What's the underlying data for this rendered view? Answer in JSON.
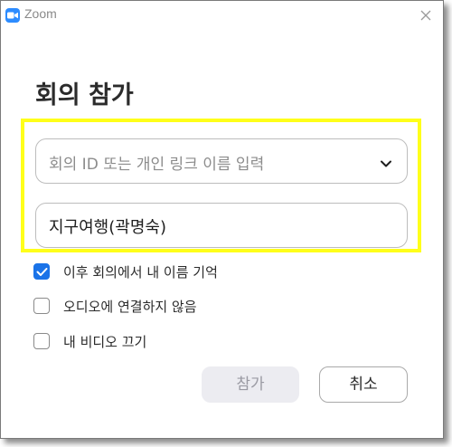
{
  "window": {
    "app_title": "Zoom",
    "logo_icon": "zoom-camera-icon",
    "close_icon": "close-icon"
  },
  "dialog": {
    "heading": "회의 참가",
    "meeting_id": {
      "value": "",
      "placeholder": "회의 ID 또는 개인 링크 이름 입력",
      "dropdown_icon": "chevron-down-icon"
    },
    "name": {
      "value": "지구여행(곽명숙)"
    },
    "highlight_color": "#ffff1a",
    "options": [
      {
        "label": "이후 회의에서 내 이름 기억",
        "checked": true
      },
      {
        "label": "오디오에 연결하지 않음",
        "checked": false
      },
      {
        "label": "내 비디오 끄기",
        "checked": false
      }
    ],
    "buttons": {
      "join_label": "참가",
      "join_enabled": false,
      "cancel_label": "취소"
    },
    "accent_color": "#1a73e8"
  }
}
